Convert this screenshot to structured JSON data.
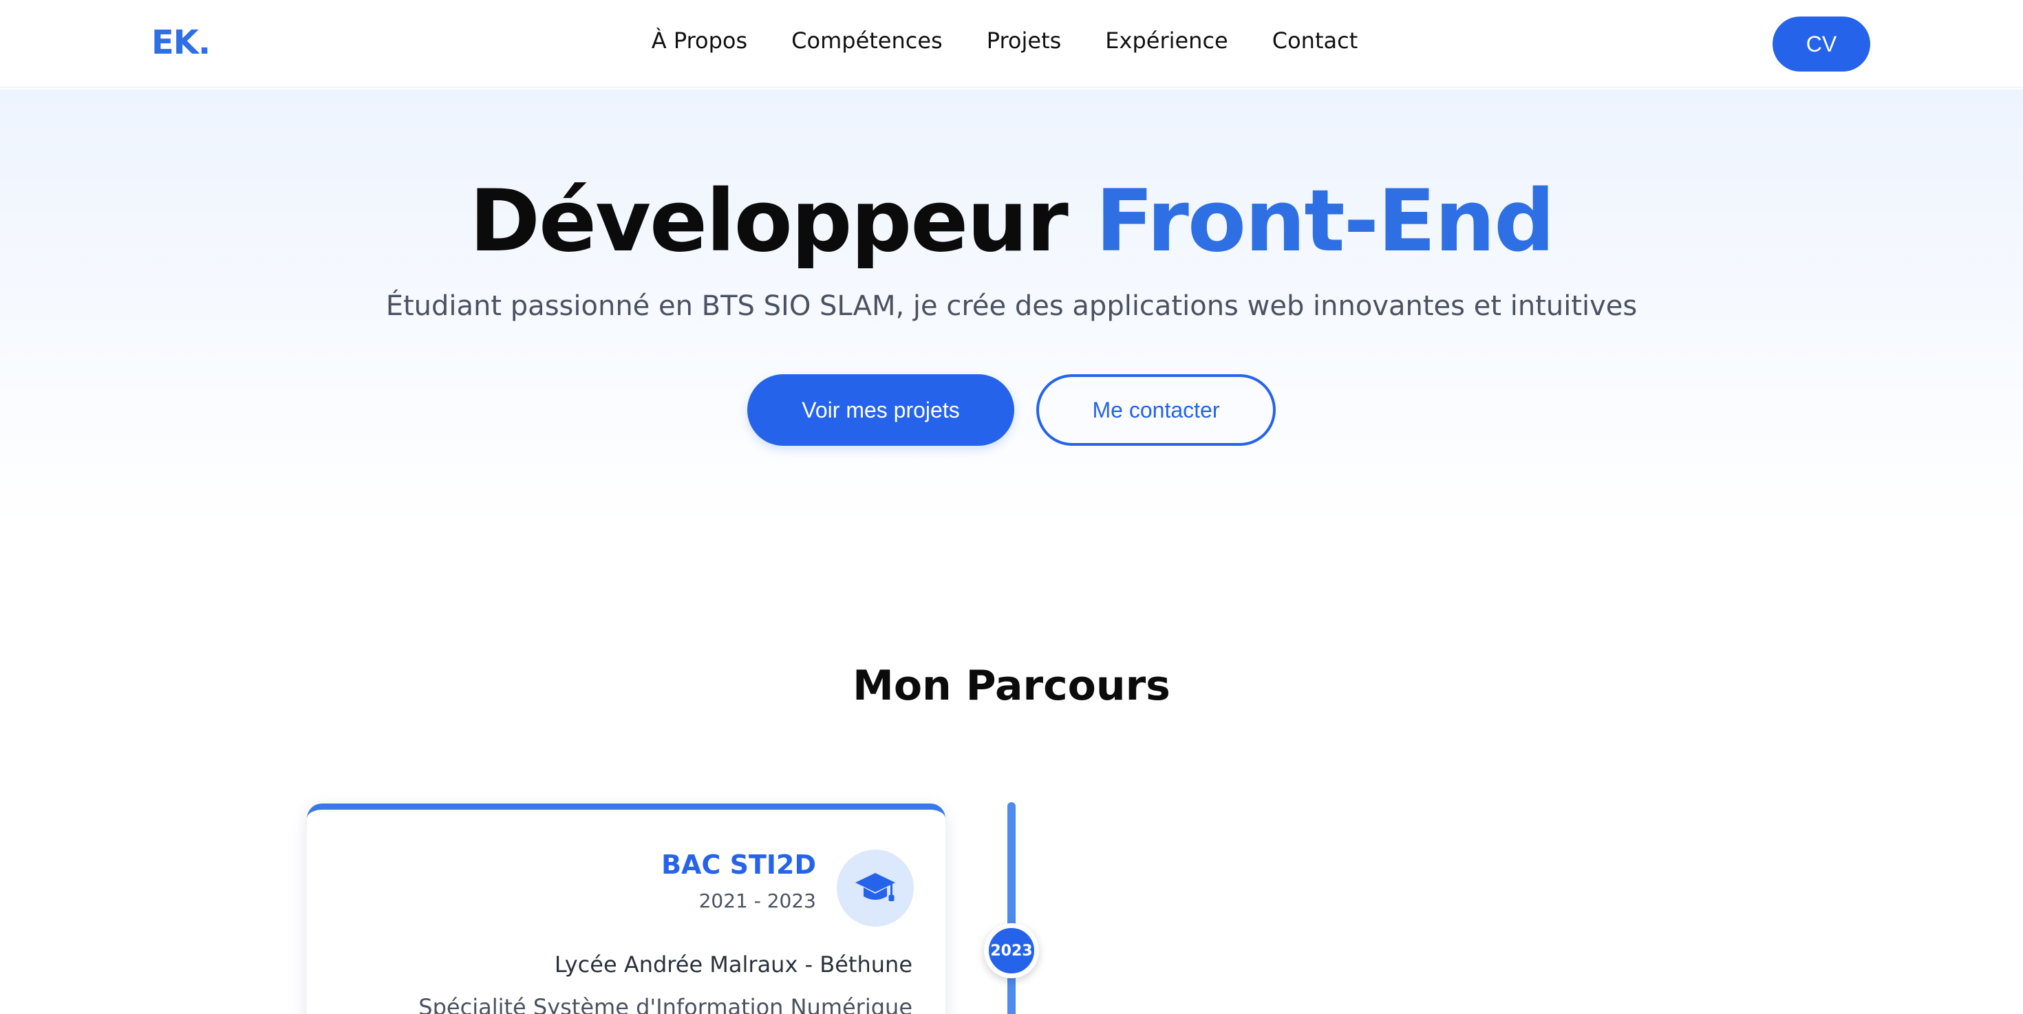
{
  "nav": {
    "logo": "EK.",
    "links": [
      "À Propos",
      "Compétences",
      "Projets",
      "Expérience",
      "Contact"
    ],
    "cv_label": "CV"
  },
  "hero": {
    "title_main": "Développeur",
    "title_accent": "Front-End",
    "subtitle": "Étudiant passionné en BTS SIO SLAM, je crée des applications web innovantes et intuitives",
    "primary_button": "Voir mes projets",
    "secondary_button": "Me contacter"
  },
  "parcours": {
    "title": "Mon Parcours",
    "timeline_year": "2023",
    "card": {
      "title": "BAC STI2D",
      "dates": "2021 - 2023",
      "school": "Lycée Andrée Malraux - Béthune",
      "speciality": "Spécialité Système d'Information Numérique",
      "icon": "graduation-cap-icon"
    }
  },
  "colors": {
    "accent": "#2563eb",
    "logo": "#2f6fe4",
    "timeline": "#4d8bf0"
  }
}
